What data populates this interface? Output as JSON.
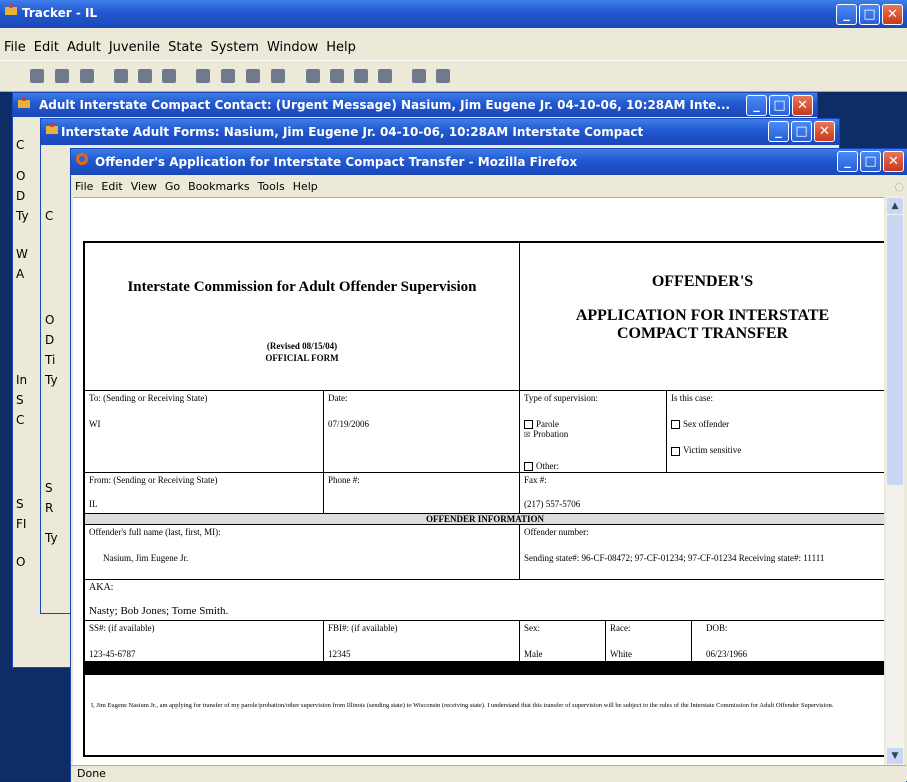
{
  "tracker": {
    "title": "Tracker - IL",
    "menu": [
      "File",
      "Edit",
      "Adult",
      "Juvenile",
      "State",
      "System",
      "Window",
      "Help"
    ]
  },
  "win2": {
    "title": "Adult Interstate Compact Contact:   (Urgent Message)   Nasium, Jim Eugene Jr.   04-10-06, 10:28AM   Inte..."
  },
  "win3": {
    "title": "Interstate Adult Forms:  Nasium, Jim Eugene Jr.   04-10-06, 10:28AM   Interstate Compact"
  },
  "bg_letters": {
    "w2": [
      "C",
      "O",
      "D",
      "Ty",
      "W",
      "A",
      "In",
      "S",
      "C",
      "S",
      "FI",
      "O"
    ],
    "w3": [
      "C",
      "O",
      "D",
      "Ti",
      "Ty",
      "S",
      "R",
      "Ty"
    ]
  },
  "firefox": {
    "title": "Offender's Application for Interstate Compact Transfer - Mozilla Firefox",
    "menu": [
      "File",
      "Edit",
      "View",
      "Go",
      "Bookmarks",
      "Tools",
      "Help"
    ],
    "status": "Done"
  },
  "form": {
    "commission": "Interstate Commission for Adult Offender Supervision",
    "revised": "(Revised 08/15/04)",
    "official": "OFFICIAL FORM",
    "title1": "OFFENDER'S",
    "title2": "APPLICATION FOR INTERSTATE COMPACT TRANSFER",
    "to_label": "To: (Sending or Receiving State)",
    "to_value": "WI",
    "date_label": "Date:",
    "date_value": "07/19/2006",
    "supervision_label": "Type of supervision:",
    "parole": "Parole",
    "probation": "Probation",
    "probation_mark": "☒",
    "other": "Other:",
    "case_label": "Is this case:",
    "sex_offender": "Sex offender",
    "victim_sensitive": "Victim sensitive",
    "from_label": "From: (Sending or Receiving State)",
    "from_value": "IL",
    "phone_label": "Phone #:",
    "fax_label": "Fax #:",
    "fax_value": "(217) 557-5706",
    "section_offender": "OFFENDER INFORMATION",
    "name_label": "Offender's full name (last, first, MI):",
    "name_value": "Nasium, Jim Eugene Jr.",
    "number_label": "Offender number:",
    "number_value": "Sending state#: 96-CF-08472; 97-CF-01234; 97-CF-01234 Receiving state#: 11111",
    "aka_label": "AKA:",
    "aka_value": "Nasty; Bob Jones; Tome Smith.",
    "ss_label": "SS#: (if available)",
    "ss_value": "123-45-6787",
    "fbi_label": "FBI#: (if available)",
    "fbi_value": "12345",
    "sex_label": "Sex:",
    "sex_value": "Male",
    "race_label": "Race:",
    "race_value": "White",
    "dob_label": "DOB:",
    "dob_value": "06/23/1966",
    "statement": "I, Jim Eugene Nasium Jr., am applying for transfer of my parole/probation/other supervision from Illinois (sending state) to Wisconsin (receiving state). I understand that this transfer of supervision will be subject to the rules of the Interstate Commission for Adult Offender Supervision."
  }
}
